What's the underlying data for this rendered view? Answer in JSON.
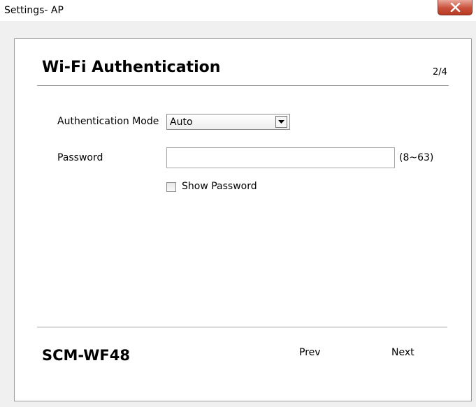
{
  "window": {
    "title": "Settings- AP",
    "close_icon": "close-icon"
  },
  "header": {
    "title": "Wi-Fi Authentication",
    "page_counter": "2/4"
  },
  "form": {
    "auth_mode_label": "Authentication Mode",
    "auth_mode_value": "Auto",
    "password_label": "Password",
    "password_value": "",
    "password_range": "(8~63)",
    "show_password_label": "Show Password",
    "show_password_checked": false
  },
  "footer": {
    "brand": "SCM-WF48",
    "prev_label": "Prev",
    "next_label": "Next"
  },
  "colors": {
    "close_button": "#c9503b",
    "panel_border": "#9a9a9a",
    "window_bg": "#f0f0f0"
  }
}
